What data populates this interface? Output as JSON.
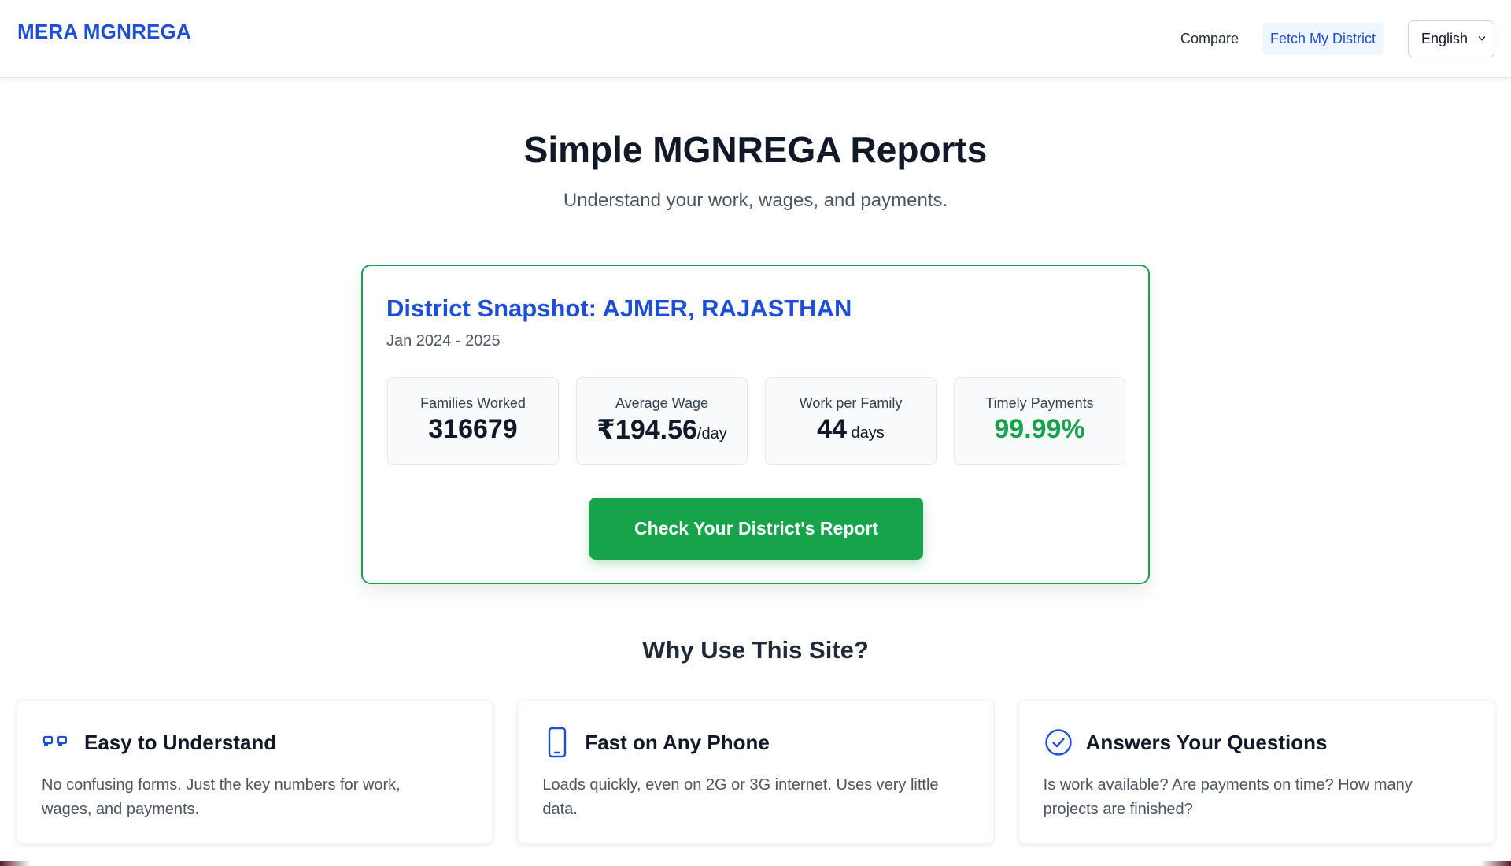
{
  "header": {
    "brand": "MERA MGNREGA",
    "nav": {
      "compare": "Compare",
      "fetch": "Fetch My District"
    },
    "language": "English"
  },
  "hero": {
    "title": "Simple MGNREGA Reports",
    "subtitle": "Understand your work, wages, and payments."
  },
  "snapshot": {
    "title": "District Snapshot: AJMER, RAJASTHAN",
    "period": "Jan 2024 - 2025",
    "stats": [
      {
        "label": "Families Worked",
        "value": "316679",
        "unit": ""
      },
      {
        "label": "Average Wage",
        "value": "₹194.56",
        "unit": "/day"
      },
      {
        "label": "Work per Family",
        "value": "44",
        "unit": " days"
      },
      {
        "label": "Timely Payments",
        "value": "99.99%",
        "unit": ""
      }
    ],
    "cta": "Check Your District's Report"
  },
  "why": {
    "title": "Why Use This Site?",
    "features": [
      {
        "title": "Easy to Understand",
        "text": "No confusing forms. Just the key numbers for work, wages, and payments.",
        "icon": "chat-bubbles-icon"
      },
      {
        "title": "Fast on Any Phone",
        "text": "Loads quickly, even on 2G or 3G internet. Uses very little data.",
        "icon": "phone-icon"
      },
      {
        "title": "Answers Your Questions",
        "text": "Is work available? Are payments on time? How many projects are finished?",
        "icon": "check-circle-icon"
      }
    ]
  },
  "colors": {
    "brand_blue": "#1d4ed8",
    "accent_green": "#16a34a"
  }
}
